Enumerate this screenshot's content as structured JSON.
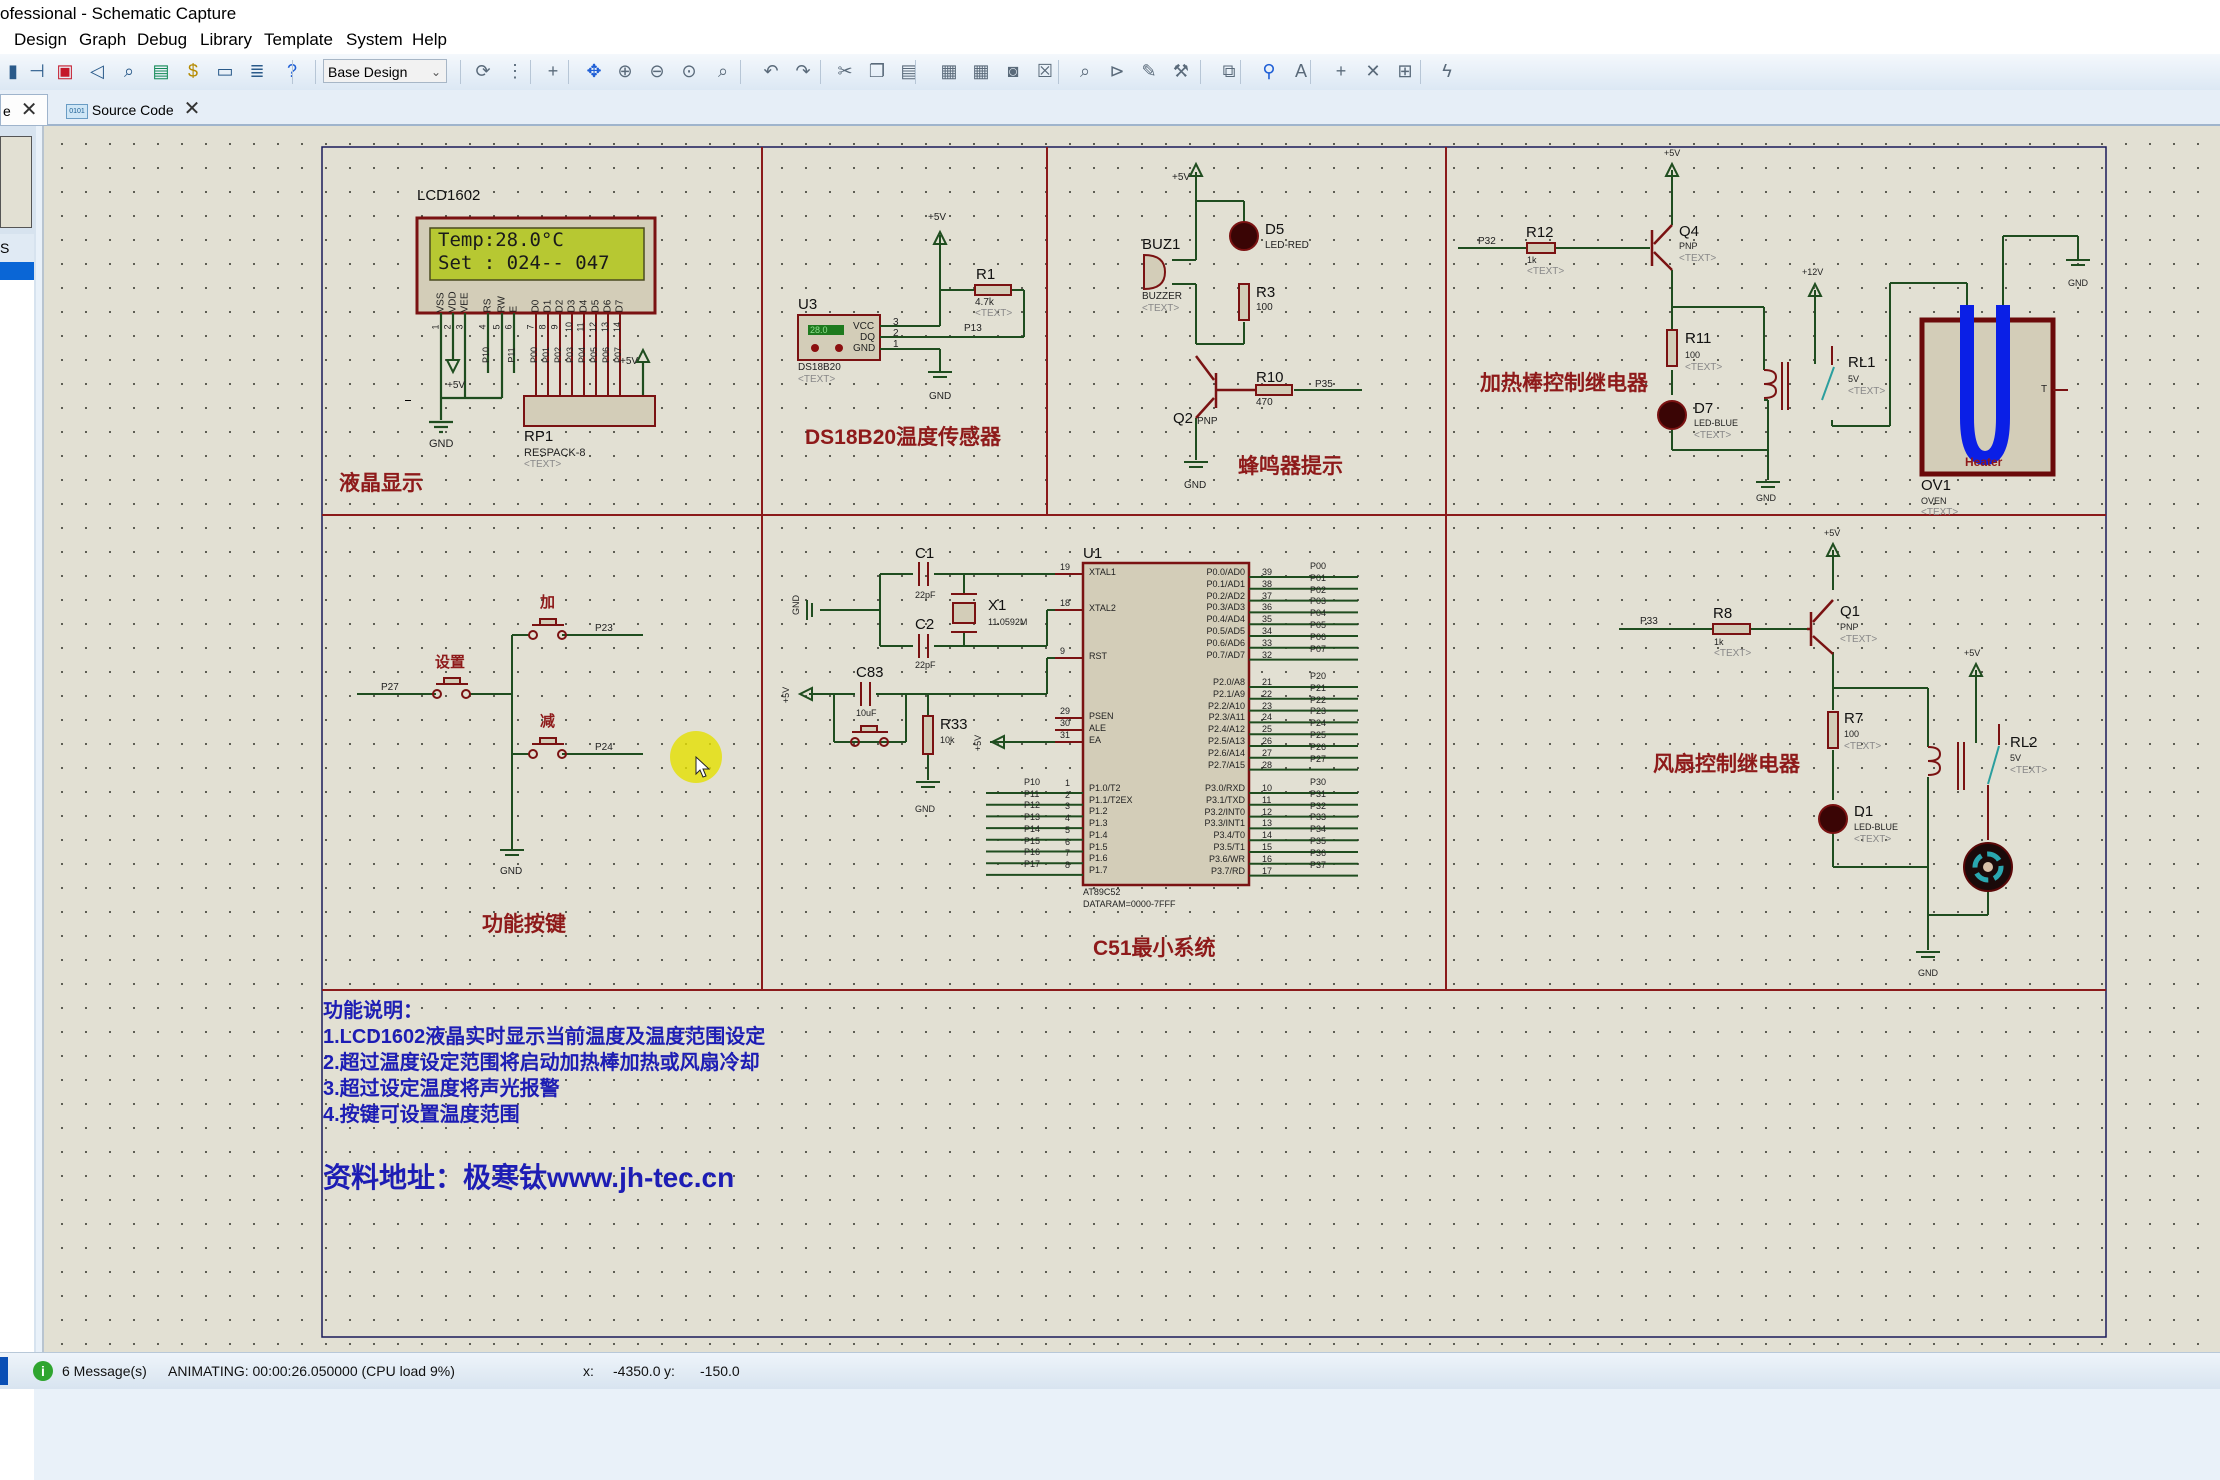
{
  "window": {
    "title": "ofessional - Schematic Capture"
  },
  "menu": [
    "Design",
    "Graph",
    "Debug",
    "Library",
    "Template",
    "System",
    "Help"
  ],
  "toolbar": {
    "design_select": "Base Design",
    "icons_left": [
      "component-icon",
      "diode-icon",
      "chip-icon",
      "probe-icon",
      "zoom-probe-icon",
      "pcb-icon",
      "bom-icon",
      "source-icon",
      "report-icon",
      "help-icon"
    ],
    "icons_right": [
      "refresh-icon",
      "grid-icon",
      "origin-icon",
      "pan-icon",
      "zoom-in-icon",
      "zoom-out-icon",
      "zoom-all-icon",
      "zoom-area-icon",
      "undo-icon",
      "redo-icon",
      "cut-icon",
      "copy-icon",
      "paste-icon",
      "block-copy-icon",
      "block-move-icon",
      "block-rotate-icon",
      "block-delete-icon",
      "pick-device-icon",
      "make-device-icon",
      "packaging-icon",
      "decompose-icon",
      "wire-autorouter-icon",
      "search-icon",
      "property-assign-icon",
      "new-sheet-icon",
      "delete-sheet-icon",
      "goto-sheet-icon",
      "netlist-icon"
    ]
  },
  "tabs": [
    {
      "label": "e",
      "active": true
    },
    {
      "label": "Source Code",
      "active": false
    }
  ],
  "left_panel": {
    "label": "S"
  },
  "sections": {
    "lcd": "液晶显示",
    "ds18b20": "DS18B20温度传感器",
    "buzzer": "蜂鸣器提示",
    "heater": "加热棒控制继电器",
    "keys": "功能按键",
    "mcu": "C51最小系统",
    "fan": "风扇控制继电器"
  },
  "lcd": {
    "ref": "LCD1602",
    "line1": "Temp:28.0°C",
    "line2": "Set : 024-- 047",
    "pins": [
      "VSS",
      "VDD",
      "VEE",
      "RS",
      "RW",
      "E",
      "D0",
      "D1",
      "D2",
      "D3",
      "D4",
      "D5",
      "D6",
      "D7"
    ],
    "pin_numbers": [
      "1",
      "2",
      "3",
      "4",
      "5",
      "6",
      "7",
      "8",
      "9",
      "10",
      "11",
      "12",
      "13",
      "14"
    ],
    "nets": [
      "P10",
      "P11",
      "P00",
      "P01",
      "P02",
      "P03",
      "P04",
      "P05",
      "P06",
      "P07"
    ],
    "rp_ref": "RP1",
    "rp_value": "RESPACK-8",
    "rp_text": "<TEXT>",
    "gnd": "GND",
    "vcc": "+5V"
  },
  "ds18b20": {
    "ref": "U3",
    "reading": "28.0",
    "model": "DS18B20",
    "text": "<TEXT>",
    "pins": [
      "VCC",
      "DQ",
      "GND"
    ],
    "pin_numbers": [
      "3",
      "2",
      "1"
    ],
    "r_ref": "R1",
    "r_value": "4.7k",
    "r_text": "<TEXT>",
    "net": "P13",
    "vcc": "+5V",
    "gnd": "GND"
  },
  "buzzer": {
    "buz_ref": "BUZ1",
    "buz_value": "BUZZER",
    "buz_text": "<TEXT>",
    "d_ref": "D5",
    "d_value": "LED-RED",
    "r3_ref": "R3",
    "r3_value": "100",
    "r10_ref": "R10",
    "r10_value": "470",
    "q_ref": "Q2",
    "q_value": "PNP",
    "net": "P35",
    "vcc": "+5V",
    "gnd": "GND"
  },
  "heater": {
    "r_ref": "R12",
    "r_value": "1k",
    "r_text": "<TEXT>",
    "net": "P32",
    "q_ref": "Q4",
    "q_value": "PNP",
    "q_text": "<TEXT>",
    "r11_ref": "R11",
    "r11_value": "100",
    "r11_text": "<TEXT>",
    "d_ref": "D7",
    "d_value": "LED-BLUE",
    "d_text": "<TEXT>",
    "rl_ref": "RL1",
    "rl_value": "5V",
    "rl_text": "<TEXT>",
    "oven_ref": "OV1",
    "oven_value": "OVEN",
    "oven_text": "<TEXT>",
    "oven_label": "Heater",
    "oven_pin": "T",
    "vcc": "+5V",
    "v12": "+12V",
    "gnd": "GND"
  },
  "keys": {
    "set": "设置",
    "plus": "加",
    "minus": "减",
    "nets": [
      "P27",
      "P23",
      "P24"
    ],
    "gnd": "GND"
  },
  "mcu": {
    "c1_ref": "C1",
    "c1_value": "22pF",
    "c2_ref": "C2",
    "c2_value": "22pF",
    "x_ref": "X1",
    "x_value": "11.0592M",
    "c83_ref": "C83",
    "c83_value": "10uF",
    "r33_ref": "R33",
    "r33_value": "10k",
    "u_ref": "U1",
    "u_model": "AT89C52",
    "u_param": "DATARAM=0000-7FFF",
    "left_pins": [
      [
        "XTAL1",
        "19"
      ],
      [
        "XTAL2",
        "18"
      ],
      [
        "RST",
        "9"
      ],
      [
        "PSEN",
        "29"
      ],
      [
        "ALE",
        "30"
      ],
      [
        "EA",
        "31"
      ]
    ],
    "p1_pins": [
      [
        "P1.0/T2",
        "1",
        "P10"
      ],
      [
        "P1.1/T2EX",
        "2",
        "P11"
      ],
      [
        "P1.2",
        "3",
        "P12"
      ],
      [
        "P1.3",
        "4",
        "P13"
      ],
      [
        "P1.4",
        "5",
        "P14"
      ],
      [
        "P1.5",
        "6",
        "P15"
      ],
      [
        "P1.6",
        "7",
        "P16"
      ],
      [
        "P1.7",
        "8",
        "P17"
      ]
    ],
    "p0_pins": [
      [
        "P0.0/AD0",
        "39",
        "P00"
      ],
      [
        "P0.1/AD1",
        "38",
        "P01"
      ],
      [
        "P0.2/AD2",
        "37",
        "P02"
      ],
      [
        "P0.3/AD3",
        "36",
        "P03"
      ],
      [
        "P0.4/AD4",
        "35",
        "P04"
      ],
      [
        "P0.5/AD5",
        "34",
        "P05"
      ],
      [
        "P0.6/AD6",
        "33",
        "P06"
      ],
      [
        "P0.7/AD7",
        "32",
        "P07"
      ]
    ],
    "p2_pins": [
      [
        "P2.0/A8",
        "21",
        "P20"
      ],
      [
        "P2.1/A9",
        "22",
        "P21"
      ],
      [
        "P2.2/A10",
        "23",
        "P22"
      ],
      [
        "P2.3/A11",
        "24",
        "P23"
      ],
      [
        "P2.4/A12",
        "25",
        "P24"
      ],
      [
        "P2.5/A13",
        "26",
        "P25"
      ],
      [
        "P2.6/A14",
        "27",
        "P26"
      ],
      [
        "P2.7/A15",
        "28",
        "P27"
      ]
    ],
    "p3_pins": [
      [
        "P3.0/RXD",
        "10",
        "P30"
      ],
      [
        "P3.1/TXD",
        "11",
        "P31"
      ],
      [
        "P3.2/INT0",
        "12",
        "P32"
      ],
      [
        "P3.3/INT1",
        "13",
        "P33"
      ],
      [
        "P3.4/T0",
        "14",
        "P34"
      ],
      [
        "P3.5/T1",
        "15",
        "P35"
      ],
      [
        "P3.6/WR",
        "16",
        "P36"
      ],
      [
        "P3.7/RD",
        "17",
        "P37"
      ]
    ],
    "gnd": "GND",
    "vcc": "+5V"
  },
  "fan": {
    "r_ref": "R8",
    "r_value": "1k",
    "r_text": "<TEXT>",
    "net": "P33",
    "q_ref": "Q1",
    "q_value": "PNP",
    "q_text": "<TEXT>",
    "r7_ref": "R7",
    "r7_value": "100",
    "r7_text": "<TEXT>",
    "d_ref": "D1",
    "d_value": "LED-BLUE",
    "d_text": "<TEXT>",
    "rl_ref": "RL2",
    "rl_value": "5V",
    "rl_text": "<TEXT>",
    "vcc": "+5V",
    "gnd": "GND"
  },
  "notes": {
    "title": "功能说明：",
    "lines": [
      "1.LCD1602液晶实时显示当前温度及温度范围设定",
      "2.超过温度设定范围将启动加热棒加热或风扇冷却",
      "3.超过设定温度将声光报警",
      "4.按键可设置温度范围"
    ],
    "source": "资料地址：极寒钛www.jh-tec.cn"
  },
  "status": {
    "messages": "6 Message(s)",
    "animation": "ANIMATING: 00:00:26.050000 (CPU load 9%)",
    "x_label": "x:",
    "x_value": "-4350.0",
    "y_label": "y:",
    "y_value": "-150.0"
  },
  "colors": {
    "wire": "#1f4d1f",
    "component": "#7a1212",
    "label": "#8e1a1a",
    "note": "#1d1db4",
    "lcd_bg": "#b7c832",
    "heater_tube": "#0a1fe6"
  }
}
